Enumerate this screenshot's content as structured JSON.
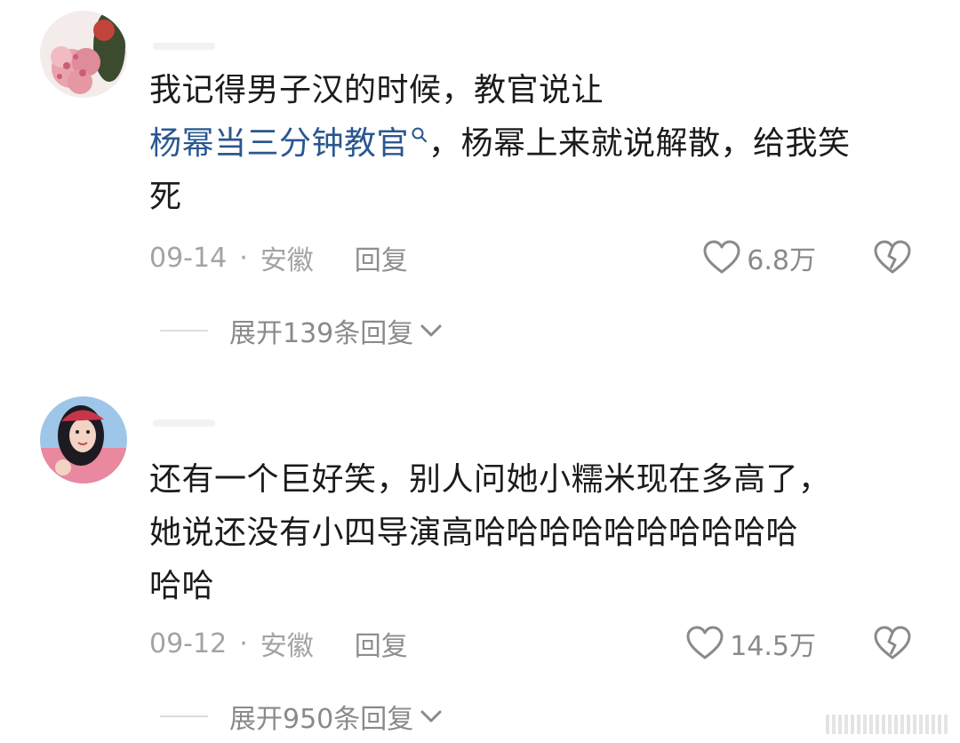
{
  "comments": [
    {
      "avatar_icon": "flower-bouquet-avatar",
      "text_part1": "我记得男子汉的时候，教官说让",
      "topic_link": "杨幂当三分钟教官",
      "text_part2": "，杨幂上来就说解散，给我笑",
      "text_part3": "死",
      "date": "09-14",
      "location": "安徽",
      "separator": "·",
      "reply_label": "回复",
      "likes": "6.8万",
      "expand_label": "展开139条回复"
    },
    {
      "avatar_icon": "woman-portrait-avatar",
      "text_line1": "还有一个巨好笑，别人问她小糯米现在多高了，",
      "text_line2": "她说还没有小四导演高哈哈哈哈哈哈哈哈哈哈",
      "text_line3": "哈哈",
      "date": "09-12",
      "location": "安徽",
      "separator": "·",
      "reply_label": "回复",
      "likes": "14.5万",
      "expand_label": "展开950条回复"
    }
  ],
  "colors": {
    "link": "#2a5790",
    "meta": "#a3a3a3",
    "text": "#1b1b1b"
  }
}
